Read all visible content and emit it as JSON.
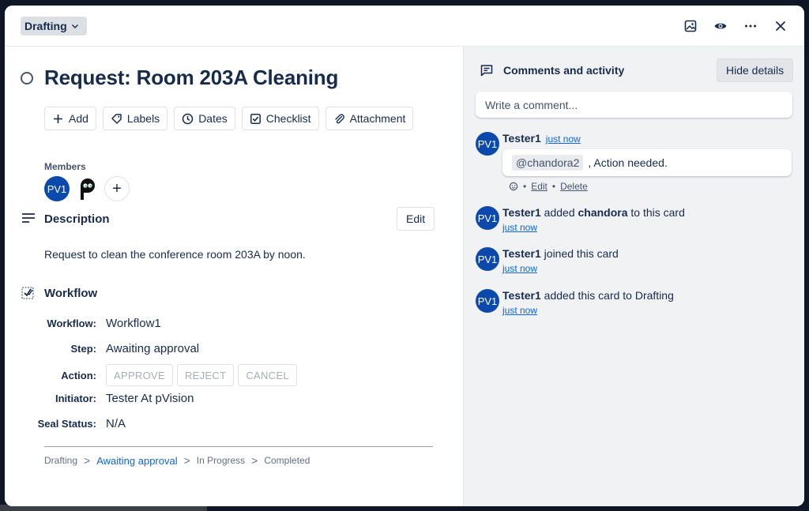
{
  "header": {
    "list_name": "Drafting"
  },
  "card": {
    "title": "Request: Room 203A Cleaning",
    "buttons": [
      "Add",
      "Labels",
      "Dates",
      "Checklist",
      "Attachment"
    ],
    "members_label": "Members",
    "members": [
      {
        "initials": "PV1",
        "type": "initials"
      },
      {
        "initials": "",
        "type": "logo"
      }
    ],
    "description_title": "Description",
    "description_edit": "Edit",
    "description_text": "Request to clean the conference room 203A by noon."
  },
  "workflow": {
    "title": "Workflow",
    "fields": {
      "workflow_label": "Workflow:",
      "workflow_value": "Workflow1",
      "step_label": "Step:",
      "step_value": "Awaiting approval",
      "action_label": "Action:",
      "initiator_label": "Initiator:",
      "initiator_value": "Tester At pVision",
      "seal_label": "Seal Status:",
      "seal_value": "N/A"
    },
    "actions": [
      "APPROVE",
      "REJECT",
      "CANCEL"
    ],
    "steps": [
      "Drafting",
      "Awaiting approval",
      "In Progress",
      "Completed"
    ],
    "current_step_index": 1,
    "separator": ">"
  },
  "sidebar": {
    "title": "Comments and activity",
    "hide_button": "Hide details",
    "comment_placeholder": "Write a comment...",
    "activity": [
      {
        "avatar": "PV1",
        "user": "Tester1",
        "time": "just now",
        "mention": "@chandora2",
        "comment": ", Action needed.",
        "edit": "Edit",
        "delete": "Delete"
      },
      {
        "avatar": "PV1",
        "user": "Tester1",
        "pre": "added",
        "bold": "chandora",
        "post": "to this card",
        "time": "just now"
      },
      {
        "avatar": "PV1",
        "user": "Tester1",
        "pre": "joined this card",
        "time": "just now"
      },
      {
        "avatar": "PV1",
        "user": "Tester1",
        "pre": "added this card to Drafting",
        "time": "just now"
      }
    ]
  },
  "colors": {
    "primary_blue": "#0c49ac",
    "link_blue": "#0c66e4",
    "sidebar_bg": "#f1f2f4",
    "backdrop": "#0f1727"
  }
}
